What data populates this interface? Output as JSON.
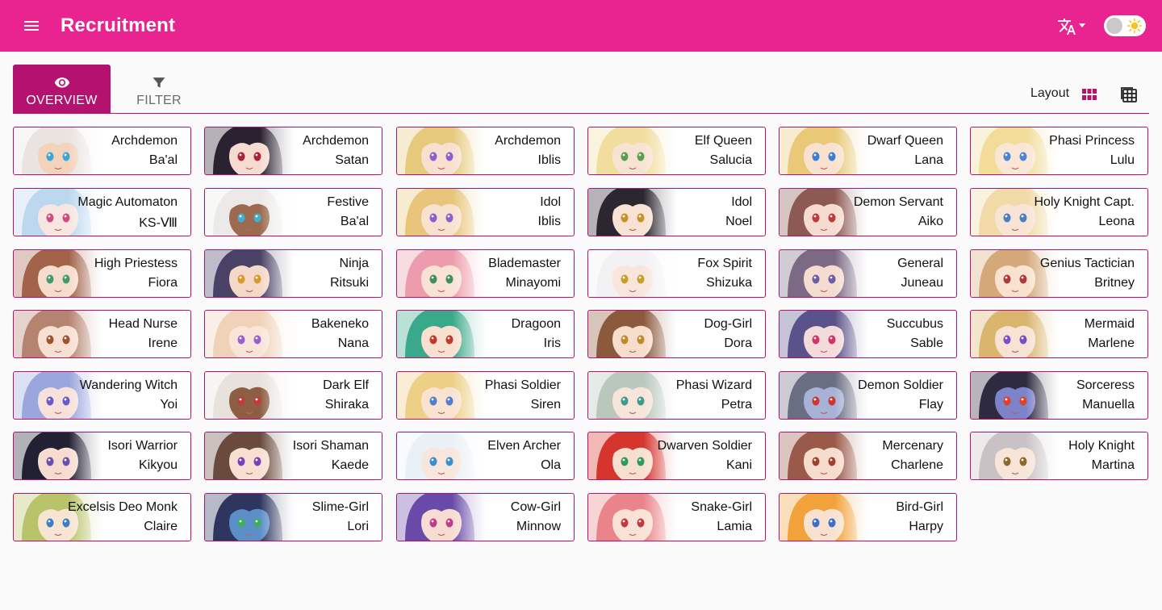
{
  "appbar": {
    "title": "Recruitment",
    "menu_icon": "menu-icon",
    "language_icon": "translate-icon",
    "theme_icon": "sun-icon",
    "color": "#e9238f"
  },
  "tabs": [
    {
      "label": "OVERVIEW",
      "icon": "eye-icon",
      "active": true
    },
    {
      "label": "FILTER",
      "icon": "filter-icon",
      "active": false
    }
  ],
  "layout": {
    "label": "Layout",
    "options": [
      {
        "icon": "grid-view-icon",
        "selected": true
      },
      {
        "icon": "table-view-icon",
        "selected": false
      }
    ]
  },
  "accent": "#b3126f",
  "cards": [
    {
      "title": "Archdemon",
      "name": "Ba'al",
      "hair": "#e9e4df",
      "skin": "#f4d3bd",
      "eyes": "#3aa6d9"
    },
    {
      "title": "Archdemon",
      "name": "Satan",
      "hair": "#2a2230",
      "skin": "#f6dcd0",
      "eyes": "#b21e3a"
    },
    {
      "title": "Archdemon",
      "name": "Iblis",
      "hair": "#e6c97c",
      "skin": "#f7e0cf",
      "eyes": "#8b5fd0"
    },
    {
      "title": "Elf Queen",
      "name": "Salucia",
      "hair": "#f1dd9d",
      "skin": "#f8e3d2",
      "eyes": "#5a9e52"
    },
    {
      "title": "Dwarf Queen",
      "name": "Lana",
      "hair": "#e9c978",
      "skin": "#f8e2cf",
      "eyes": "#3a7fd6"
    },
    {
      "title": "Phasi Princess",
      "name": "Lulu",
      "hair": "#f2dc9a",
      "skin": "#f9e6d6",
      "eyes": "#4a85d8"
    },
    {
      "title": "Magic Automaton",
      "name": "KS-Ⅷ",
      "hair": "#bcd8ef",
      "skin": "#f7e6e0",
      "eyes": "#d04c7c"
    },
    {
      "title": "Festive",
      "name": "Ba'al",
      "hair": "#eceae8",
      "skin": "#9c6a4e",
      "eyes": "#3bb1d6"
    },
    {
      "title": "Idol",
      "name": "Iblis",
      "hair": "#e8c57a",
      "skin": "#f8e1cf",
      "eyes": "#8b5fd0"
    },
    {
      "title": "Idol",
      "name": "Noel",
      "hair": "#2c2630",
      "skin": "#f7e2d3",
      "eyes": "#c7922a"
    },
    {
      "title": "Demon Servant",
      "name": "Aiko",
      "hair": "#8c5a52",
      "skin": "#f6dcd0",
      "eyes": "#c23a3a"
    },
    {
      "title": "Holy Knight Capt.",
      "name": "Leona",
      "hair": "#f1d9a8",
      "skin": "#f8e4d4",
      "eyes": "#4b7fbf"
    },
    {
      "title": "High Priestess",
      "name": "Fiora",
      "hair": "#a2634a",
      "skin": "#f6dccc",
      "eyes": "#3f9c6a"
    },
    {
      "title": "Ninja",
      "name": "Ritsuki",
      "hair": "#4a4266",
      "skin": "#f4d8c8",
      "eyes": "#d99a2a"
    },
    {
      "title": "Blademaster",
      "name": "Minayomi",
      "hair": "#ec9cac",
      "skin": "#f8e2d6",
      "eyes": "#3c8f5e"
    },
    {
      "title": "Fox Spirit",
      "name": "Shizuka",
      "hair": "#f2f1f3",
      "skin": "#f8e6dc",
      "eyes": "#c7a02a"
    },
    {
      "title": "General",
      "name": "Juneau",
      "hair": "#7c6a84",
      "skin": "#f5dcd0",
      "eyes": "#6b5ba8"
    },
    {
      "title": "Genius Tactician",
      "name": "Britney",
      "hair": "#d4a878",
      "skin": "#f8e1cf",
      "eyes": "#b03a3a"
    },
    {
      "title": "Head Nurse",
      "name": "Irene",
      "hair": "#b58470",
      "skin": "#f7dfd2",
      "eyes": "#a0522d"
    },
    {
      "title": "Bakeneko",
      "name": "Nana",
      "hair": "#f0d2b8",
      "skin": "#f9e5d8",
      "eyes": "#9b5fd0"
    },
    {
      "title": "Dragoon",
      "name": "Iris",
      "hair": "#3aa88a",
      "skin": "#f7e0d0",
      "eyes": "#c0392b"
    },
    {
      "title": "Dog-Girl",
      "name": "Dora",
      "hair": "#8b5a3c",
      "skin": "#f7ddcc",
      "eyes": "#c08a2a"
    },
    {
      "title": "Succubus",
      "name": "Sable",
      "hair": "#5a528a",
      "skin": "#f3dadb",
      "eyes": "#d0356a"
    },
    {
      "title": "Mermaid",
      "name": "Marlene",
      "hair": "#d9b56e",
      "skin": "#f8e2d3",
      "eyes": "#7a4fc4"
    },
    {
      "title": "Wandering Witch",
      "name": "Yoi",
      "hair": "#9aa6de",
      "skin": "#f7e2db",
      "eyes": "#6a59c9"
    },
    {
      "title": "Dark Elf",
      "name": "Shiraka",
      "hair": "#e8e2dc",
      "skin": "#8d5e44",
      "eyes": "#c23a3a"
    },
    {
      "title": "Phasi Soldier",
      "name": "Siren",
      "hair": "#edcf86",
      "skin": "#f8e2d0",
      "eyes": "#4f7ed0"
    },
    {
      "title": "Phasi Wizard",
      "name": "Petra",
      "hair": "#b9c7bd",
      "skin": "#f7e4da",
      "eyes": "#3f9c8a"
    },
    {
      "title": "Demon Soldier",
      "name": "Flay",
      "hair": "#6a6e82",
      "skin": "#a8b2d6",
      "eyes": "#d0352a"
    },
    {
      "title": "Sorceress",
      "name": "Manuella",
      "hair": "#2e2a40",
      "skin": "#7d83c9",
      "eyes": "#e0402a"
    },
    {
      "title": "Isori Warrior",
      "name": "Kikyou",
      "hair": "#222033",
      "skin": "#f6ddd0",
      "eyes": "#6b4fb0"
    },
    {
      "title": "Isori Shaman",
      "name": "Kaede",
      "hair": "#6b4a3e",
      "skin": "#f7e0d2",
      "eyes": "#7a3fc0"
    },
    {
      "title": "Elven Archer",
      "name": "Ola",
      "hair": "#eaf1f6",
      "skin": "#f8e6dc",
      "eyes": "#3a8fd0"
    },
    {
      "title": "Dwarven Soldier",
      "name": "Kani",
      "hair": "#d6352e",
      "skin": "#f7dfd0",
      "eyes": "#2a9c5a"
    },
    {
      "title": "Mercenary",
      "name": "Charlene",
      "hair": "#9a5a4a",
      "skin": "#f6dccc",
      "eyes": "#a0402a"
    },
    {
      "title": "Holy Knight",
      "name": "Martina",
      "hair": "#c9c2c4",
      "skin": "#f8e5da",
      "eyes": "#8a6a2a"
    },
    {
      "title": "Excelsis Deo Monk",
      "name": "Claire",
      "hair": "#b8c46a",
      "skin": "#f8e4d2",
      "eyes": "#3a7fc6"
    },
    {
      "title": "Slime-Girl",
      "name": "Lori",
      "hair": "#2e3660",
      "skin": "#5c8fc8",
      "eyes": "#3ab05a"
    },
    {
      "title": "Cow-Girl",
      "name": "Minnow",
      "hair": "#6a4aa8",
      "skin": "#f6dcd2",
      "eyes": "#c23a8a"
    },
    {
      "title": "Snake-Girl",
      "name": "Lamia",
      "hair": "#e9848a",
      "skin": "#f8e1d6",
      "eyes": "#c23a3a"
    },
    {
      "title": "Bird-Girl",
      "name": "Harpy",
      "hair": "#f2a23a",
      "skin": "#f8e2cf",
      "eyes": "#3a6fd0"
    }
  ]
}
